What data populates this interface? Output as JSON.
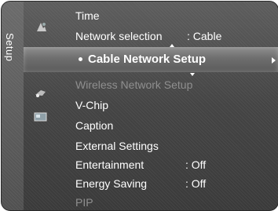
{
  "menu": {
    "tab_label": "Setup",
    "items": [
      {
        "label": "Time",
        "value": ""
      },
      {
        "label": "Network selection",
        "value": ": Cable"
      },
      {
        "label": "Cable Network Setup",
        "value": ""
      },
      {
        "label": "Wireless Network Setup",
        "value": ""
      },
      {
        "label": "V-Chip",
        "value": ""
      },
      {
        "label": "Caption",
        "value": ""
      },
      {
        "label": "External Settings",
        "value": ""
      },
      {
        "label": "Entertainment",
        "value": ": Off"
      },
      {
        "label": "Energy Saving",
        "value": ": Off"
      },
      {
        "label": "PIP",
        "value": ""
      }
    ],
    "selected_index": 2,
    "icons": [
      "picture-icon",
      "gear-icon",
      "input-icon",
      "application-icon"
    ]
  },
  "colors": {
    "text": "#ffffff",
    "disabled_text": "#8f8f8f",
    "background": "#444444",
    "highlight": "#7a7a7a"
  }
}
